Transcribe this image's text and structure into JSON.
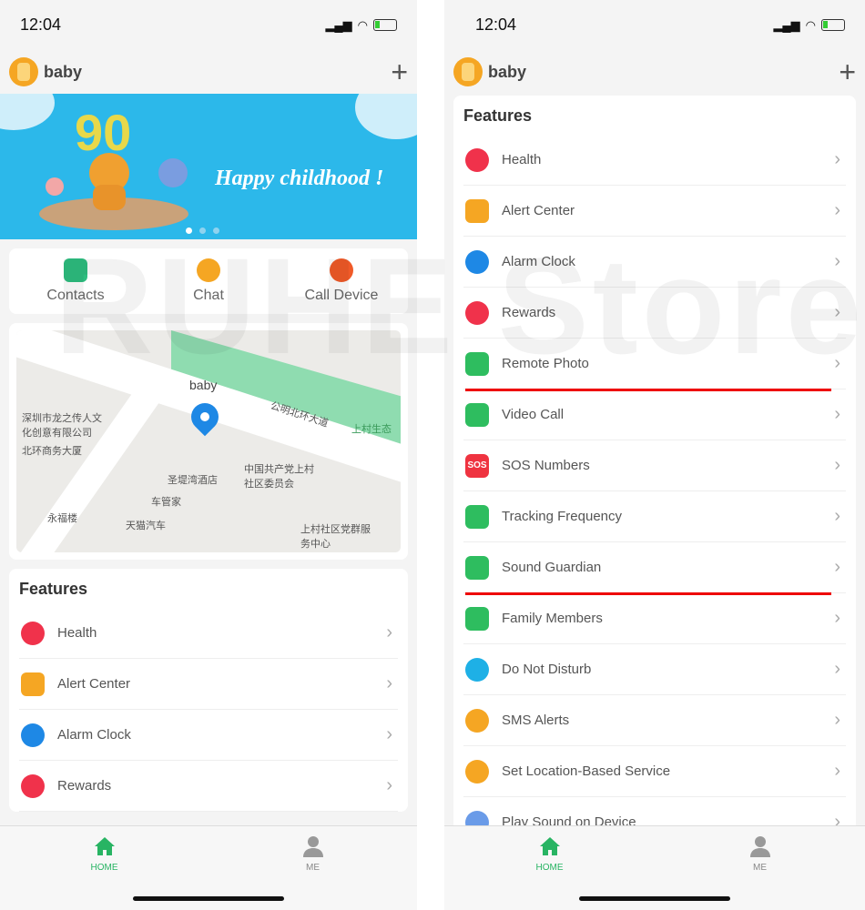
{
  "left": {
    "status": {
      "time": "12:04"
    },
    "header": {
      "device_name": "baby"
    },
    "banner": {
      "caption": "Happy childhood !",
      "slide_index": 1,
      "slide_count": 3
    },
    "quick_actions": [
      {
        "label": "Contacts",
        "color": "#2ebd7f"
      },
      {
        "label": "Chat",
        "color": "#f5a623"
      },
      {
        "label": "Call Device",
        "color": "#f05a28"
      }
    ],
    "map": {
      "marker_label": "baby",
      "places": [
        "深圳市龙之传人文化创意有限公司",
        "北环商务大厦",
        "公明北环大道",
        "上村生态",
        "圣堤湾酒店",
        "中国共产党上村社区委员会",
        "车管家",
        "永福楼",
        "天猫汽车",
        "上村社区党群服务中心"
      ]
    },
    "features": {
      "title": "Features",
      "items": [
        {
          "label": "Health",
          "icon": "heart-icon",
          "color": "#f0324b"
        },
        {
          "label": "Alert Center",
          "icon": "message-icon",
          "color": "#f5a623"
        },
        {
          "label": "Alarm Clock",
          "icon": "alarm-clock-icon",
          "color": "#1e88e5"
        },
        {
          "label": "Rewards",
          "icon": "hearts-icon",
          "color": "#f0324b"
        }
      ]
    },
    "tabs": [
      {
        "label": "HOME",
        "active": true
      },
      {
        "label": "ME",
        "active": false
      }
    ]
  },
  "right": {
    "status": {
      "time": "12:04"
    },
    "header": {
      "device_name": "baby"
    },
    "features": {
      "title": "Features",
      "items": [
        {
          "label": "Health",
          "icon": "heart-icon",
          "color": "#f0324b"
        },
        {
          "label": "Alert Center",
          "icon": "message-icon",
          "color": "#f5a623"
        },
        {
          "label": "Alarm Clock",
          "icon": "alarm-clock-icon",
          "color": "#1e88e5"
        },
        {
          "label": "Rewards",
          "icon": "hearts-icon",
          "color": "#f0324b"
        },
        {
          "label": "Remote Photo",
          "icon": "camera-icon",
          "color": "#2ebd5f",
          "highlighted": true
        },
        {
          "label": "Video Call",
          "icon": "video-call-icon",
          "color": "#2ebd5f"
        },
        {
          "label": "SOS Numbers",
          "icon": "sos-icon",
          "color": "#ef3340",
          "text": "SOS"
        },
        {
          "label": "Tracking Frequency",
          "icon": "tracking-icon",
          "color": "#2ebd5f"
        },
        {
          "label": "Sound Guardian",
          "icon": "shield-phone-icon",
          "color": "#2ebd5f",
          "highlighted": true
        },
        {
          "label": "Family Members",
          "icon": "family-icon",
          "color": "#2ebd5f"
        },
        {
          "label": "Do Not Disturb",
          "icon": "mute-icon",
          "color": "#1eb0e6"
        },
        {
          "label": "SMS Alerts",
          "icon": "bell-icon",
          "color": "#f5a623"
        },
        {
          "label": "Set Location-Based Service",
          "icon": "location-service-icon",
          "color": "#f5a623"
        },
        {
          "label": "Play Sound on Device",
          "icon": "sound-icon",
          "color": "#6a9be8"
        }
      ]
    },
    "tabs": [
      {
        "label": "HOME",
        "active": true
      },
      {
        "label": "ME",
        "active": false
      }
    ]
  },
  "watermark": "RUHE Store",
  "colors": {
    "accent": "#28b463",
    "highlight_line": "#e00000",
    "banner": "#2cb8ea"
  }
}
